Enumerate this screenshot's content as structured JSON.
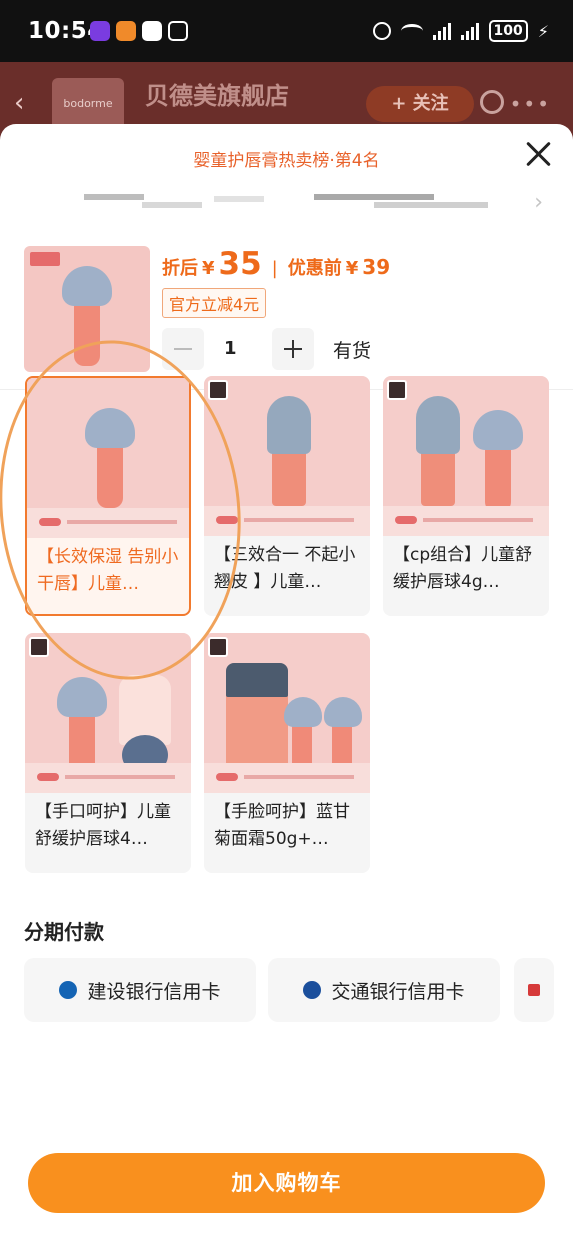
{
  "status_bar": {
    "time": "10:54",
    "battery": "100"
  },
  "store_header": {
    "logo_text": "bodorme",
    "store_name": "贝德美旗舰店",
    "follow_label": "+ 关注"
  },
  "sheet": {
    "rank_title": "婴童护唇膏热卖榜·第4名",
    "product": {
      "price_after_label": "折后",
      "currency": "¥",
      "price_after": "35",
      "price_before_label": "优惠前",
      "price_before": "39",
      "separator": "|",
      "discount_tag": "官方立减4元",
      "quantity": "1",
      "stock": "有货"
    },
    "variants": [
      {
        "label": "【长效保湿 告别小干唇】儿童…",
        "selected": true
      },
      {
        "label": "【三效合一 不起小翘皮 】儿童…",
        "selected": false
      },
      {
        "label": "【cp组合】儿童舒缓护唇球4g…",
        "selected": false
      },
      {
        "label": "【手口呵护】儿童舒缓护唇球4…",
        "selected": false
      },
      {
        "label": "【手脸呵护】蓝甘菊面霜50g+…",
        "selected": false
      }
    ],
    "installment": {
      "title": "分期付款",
      "banks": [
        {
          "name": "建设银行信用卡",
          "icon": "ccb-icon",
          "color": "#1464b4"
        },
        {
          "name": "交通银行信用卡",
          "icon": "bocom-icon",
          "color": "#1b4f9c"
        }
      ]
    },
    "add_to_cart_label": "加入购物车"
  },
  "colors": {
    "accent": "#f9901e",
    "price": "#ee6a1a",
    "selected_border": "#f27a2e"
  }
}
